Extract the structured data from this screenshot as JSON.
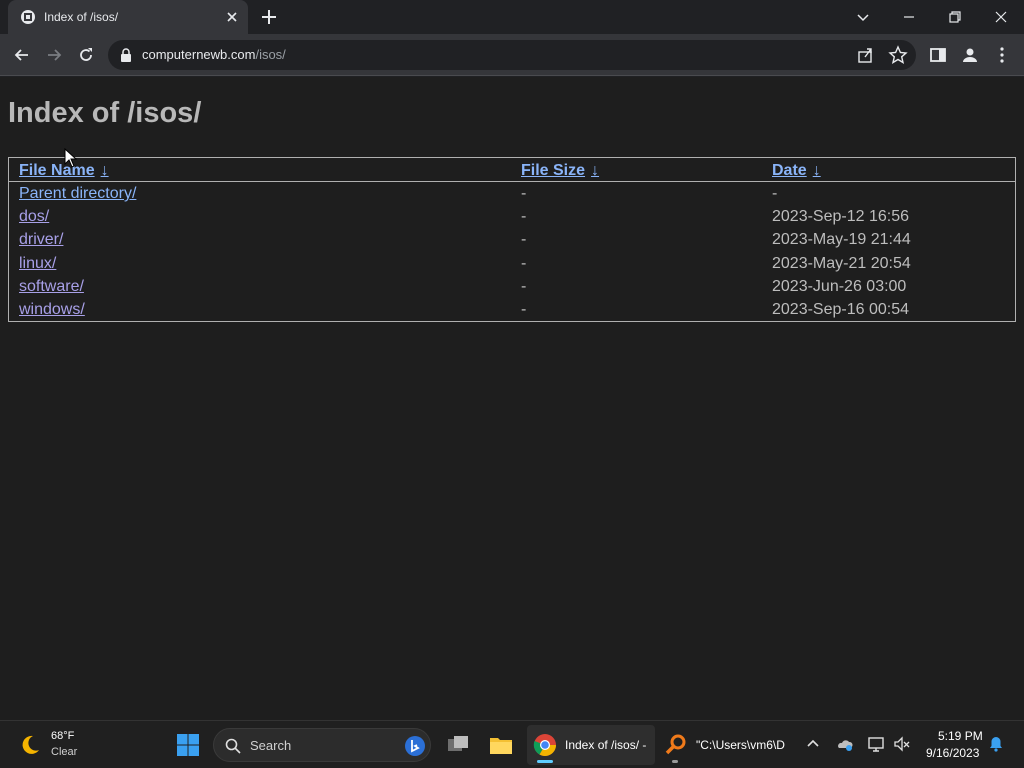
{
  "browser": {
    "tab_title": "Index of /isos/",
    "url_host": "computernewb.com",
    "url_path": "/isos/"
  },
  "page": {
    "title": "Index of /isos/",
    "columns": [
      {
        "label": "File Name",
        "sort_indicator": "↓"
      },
      {
        "label": "File Size",
        "sort_indicator": "↓"
      },
      {
        "label": "Date",
        "sort_indicator": "↓"
      }
    ],
    "rows": [
      {
        "name": "Parent directory/",
        "size": "-",
        "date": "-"
      },
      {
        "name": "dos/",
        "size": "-",
        "date": "2023-Sep-12 16:56"
      },
      {
        "name": "driver/",
        "size": "-",
        "date": "2023-May-19 21:44"
      },
      {
        "name": "linux/",
        "size": "-",
        "date": "2023-May-21 20:54"
      },
      {
        "name": "software/",
        "size": "-",
        "date": "2023-Jun-26 03:00"
      },
      {
        "name": "windows/",
        "size": "-",
        "date": "2023-Sep-16 00:54"
      }
    ]
  },
  "taskbar": {
    "weather_temp": "68°F",
    "weather_condition": "Clear",
    "search_placeholder": "Search",
    "chrome_label": "Index of /isos/ -",
    "terminal_label": "\"C:\\Users\\vm6\\D",
    "time": "5:19 PM",
    "date": "9/16/2023"
  },
  "colors": {
    "link": "#8ab4f8",
    "visited_link": "#a8a0e8",
    "page_bg": "#1e1e1e",
    "chrome_bg": "#202124"
  }
}
